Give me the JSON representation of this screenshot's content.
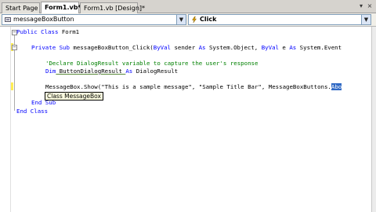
{
  "tabs": [
    {
      "label": "Start Page"
    },
    {
      "label": "Form1.vb*"
    },
    {
      "label": "Form1.vb [Design]*"
    }
  ],
  "window_buttons": {
    "close": "×",
    "pin": "▾"
  },
  "navigation": {
    "object_combo": "messageBoxButton",
    "member_combo": "Click"
  },
  "code_lines": {
    "line1_kw": "Public Class",
    "line1_rest": " Form1",
    "line2_kw1": "Private Sub",
    "line2_mid": " messageBoxButton_Click(",
    "line2_kw2": "ByVal",
    "line2_mid2": " sender ",
    "line2_kw3": "As",
    "line2_mid3": " System.Object, ",
    "line2_kw4": "ByVal",
    "line2_mid4": " e ",
    "line2_kw5": "As",
    "line2_rest": " System.Event",
    "comment": "'Declare DialogResult variable to capture the user's response",
    "dim_kw": "Dim",
    "dim_name": " ButtonDialogResult ",
    "dim_as": "As",
    "dim_type": " DialogResult",
    "msg_line": "MessageBox.Show(\"This is a sample message\", \"Sample Title Bar\", MessageBoxButtons.",
    "msg_sel": "Abo",
    "endsub_kw": "End Sub",
    "endclass_kw": "End Class"
  },
  "tooltip": "Class MessageBox"
}
